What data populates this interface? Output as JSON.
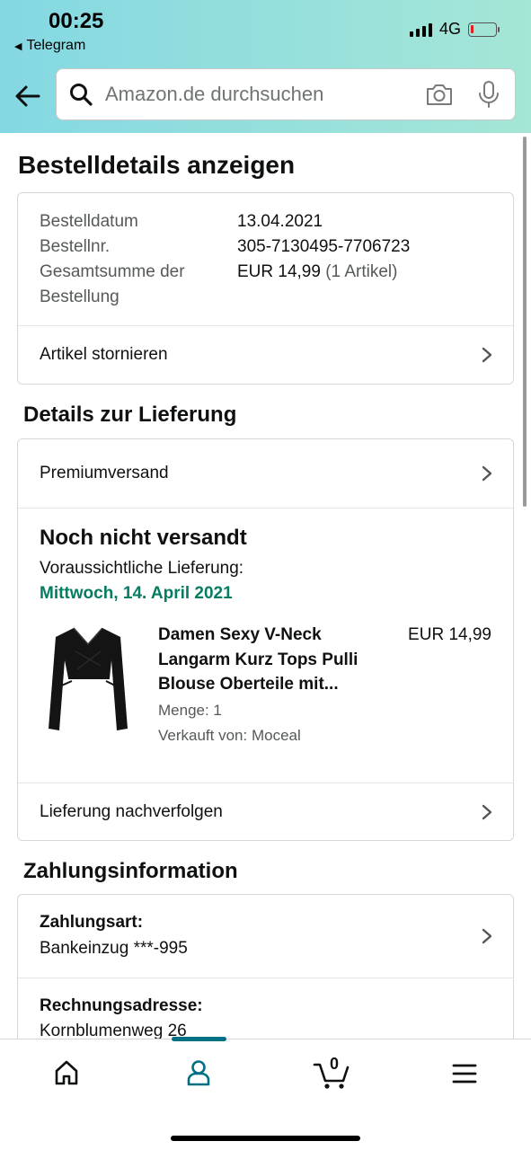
{
  "status_bar": {
    "time": "00:25",
    "back_app": "Telegram",
    "network": "4G"
  },
  "search": {
    "placeholder": "Amazon.de durchsuchen"
  },
  "page": {
    "title": "Bestelldetails anzeigen"
  },
  "order": {
    "date_label": "Bestelldatum",
    "date_value": "13.04.2021",
    "number_label": "Bestellnr.",
    "number_value": "305-7130495-7706723",
    "total_label": "Gesamtsumme der Bestellung",
    "total_value": "EUR 14,99",
    "total_items": "(1 Artikel)",
    "cancel_label": "Artikel stornieren"
  },
  "delivery": {
    "section_title": "Details zur Lieferung",
    "shipping_method": "Premiumversand",
    "status": "Noch nicht versandt",
    "expected_label": "Voraussichtliche Lieferung:",
    "expected_date": "Mittwoch, 14. April 2021",
    "item": {
      "title": "Damen Sexy V-Neck Langarm Kurz Tops Pulli Blouse Oberteile mit...",
      "price": "EUR 14,99",
      "quantity": "Menge: 1",
      "seller": "Verkauft von: Moceal",
      "image_icon": "black-crop-top-image"
    },
    "track_label": "Lieferung nachverfolgen"
  },
  "payment": {
    "section_title": "Zahlungsinformation",
    "method_label": "Zahlungsart:",
    "method_value": "Bankeinzug ***-995",
    "billing_label": "Rechnungsadresse:",
    "billing_value": "Kornblumenweg 26"
  },
  "bottom_nav": {
    "items": [
      "home-icon",
      "account-icon",
      "cart-icon",
      "menu-icon"
    ],
    "cart_count": "0",
    "active": "account-icon"
  },
  "colors": {
    "accent": "#007185",
    "delivery_green": "#067d62",
    "header_start": "#84d8e3",
    "header_end": "#a5e6d6"
  }
}
